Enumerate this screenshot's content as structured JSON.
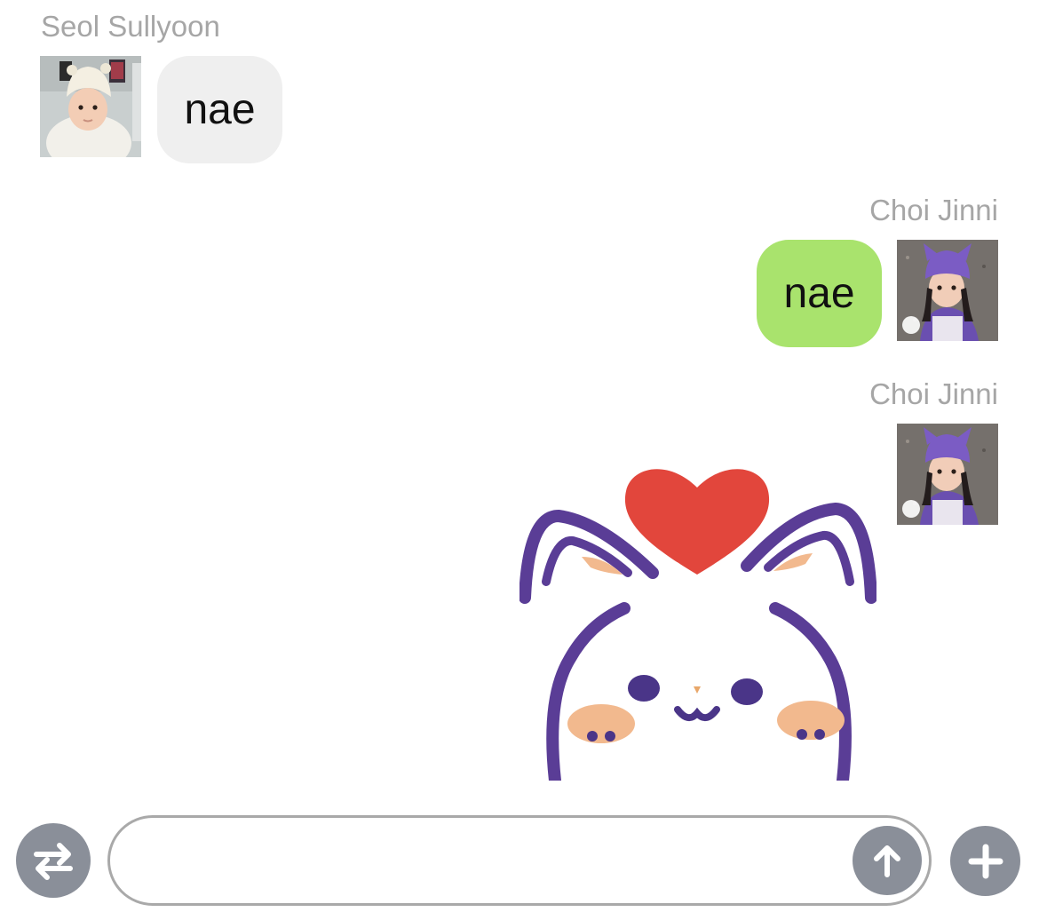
{
  "messages": [
    {
      "sender": "Seol Sullyoon",
      "text": "nae",
      "direction": "received",
      "avatar": "baby-in-white-bear-hat-photo"
    },
    {
      "sender": "Choi Jinni",
      "text": "nae",
      "direction": "sent",
      "avatar": "child-in-purple-cat-beanie-photo"
    },
    {
      "sender": "Choi Jinni",
      "sticker": "white-cat-with-red-heart-sticker",
      "direction": "sent",
      "avatar": "child-in-purple-cat-beanie-photo"
    }
  ],
  "composer": {
    "switch_icon": "swap-arrows-icon",
    "input_value": "",
    "input_placeholder": "",
    "send_icon": "arrow-up-icon",
    "add_icon": "plus-icon"
  },
  "colors": {
    "received_bubble": "#efefef",
    "sent_bubble": "#a9e36d",
    "sender_name": "#a6a6a6",
    "button": "#8a8f99",
    "input_border": "#a9a9a9",
    "sticker_outline": "#5a3d96",
    "sticker_heart": "#e2463c"
  }
}
